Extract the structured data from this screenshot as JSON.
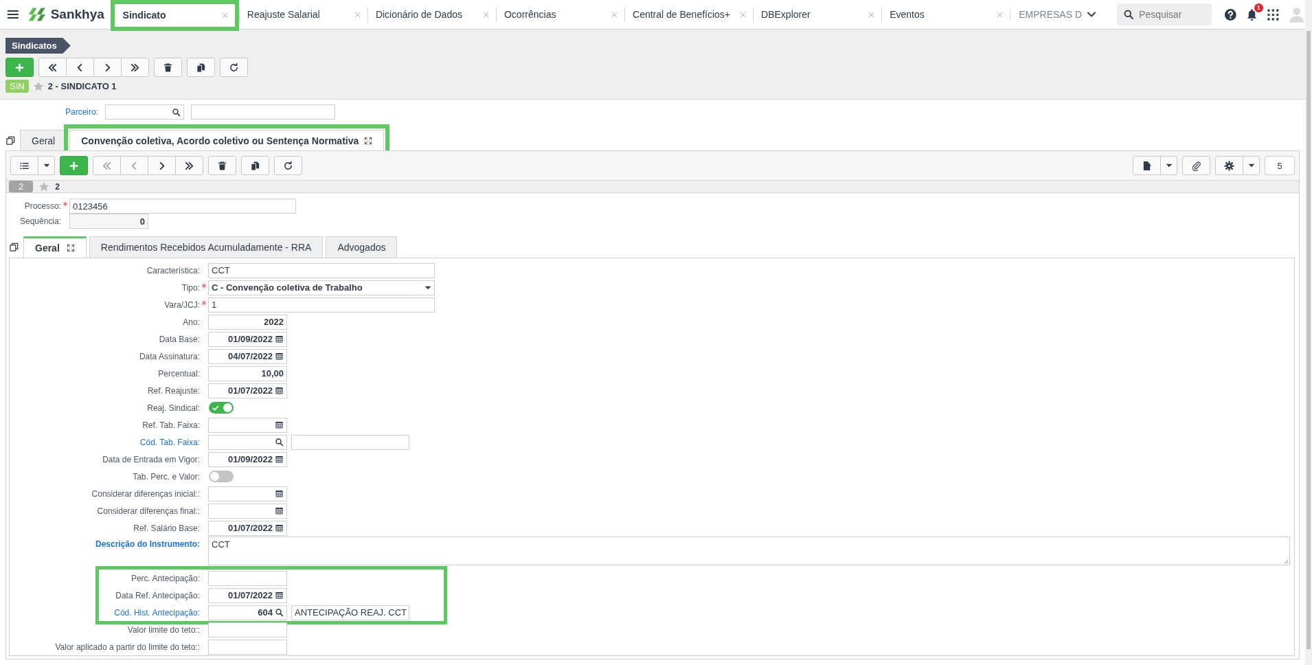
{
  "top_bar": {
    "brand": "Sankhya",
    "tabs": [
      {
        "label": "Sindicato",
        "selected": true,
        "highlighted": true
      },
      {
        "label": "Reajuste Salarial",
        "selected": false,
        "highlighted": false
      },
      {
        "label": "Dicionário de Dados",
        "selected": false,
        "highlighted": false
      },
      {
        "label": "Ocorrências",
        "selected": false,
        "highlighted": false
      },
      {
        "label": "Central de Benefícios+",
        "selected": false,
        "highlighted": false
      },
      {
        "label": "DBExplorer",
        "selected": false,
        "highlighted": false
      },
      {
        "label": "Eventos",
        "selected": false,
        "highlighted": false
      }
    ],
    "company_selector": {
      "label": "EMPRESAS D"
    },
    "search": {
      "placeholder": "Pesquisar"
    },
    "notification_count": "1"
  },
  "header": {
    "breadcrumb": "Sindicatos",
    "toolbar": [
      [
        {
          "kind": "add",
          "disabled": false
        }
      ],
      [
        {
          "kind": "first",
          "disabled": false
        },
        {
          "kind": "prev",
          "disabled": false
        },
        {
          "kind": "next",
          "disabled": false
        },
        {
          "kind": "last",
          "disabled": false
        }
      ],
      [
        {
          "kind": "trash",
          "disabled": false
        }
      ],
      [
        {
          "kind": "copy",
          "disabled": false
        }
      ],
      [
        {
          "kind": "refresh",
          "disabled": false
        }
      ]
    ],
    "badge": "SIN",
    "record_title": "2 - SINDICATO 1"
  },
  "form": {
    "parceiro": {
      "label": "Parceiro:"
    },
    "tabs": [
      {
        "label": "Geral",
        "selected": false,
        "highlighted": false
      },
      {
        "label": "Convenção coletiva, Acordo coletivo ou Sentença Normativa",
        "selected": true,
        "highlighted": true
      }
    ],
    "toolbar": [
      [
        {
          "kind": "list",
          "disabled": false
        },
        {
          "kind": "caret",
          "disabled": false
        }
      ],
      [
        {
          "kind": "add",
          "disabled": false
        }
      ],
      [
        {
          "kind": "first",
          "disabled": true
        },
        {
          "kind": "prev",
          "disabled": true
        },
        {
          "kind": "next",
          "disabled": false
        },
        {
          "kind": "last",
          "disabled": false
        }
      ],
      [
        {
          "kind": "trash",
          "disabled": false
        }
      ],
      [
        {
          "kind": "copy",
          "disabled": false
        }
      ],
      [
        {
          "kind": "refresh",
          "disabled": false
        }
      ]
    ],
    "toolbar_right": [
      [
        {
          "kind": "doc",
          "disabled": false
        },
        {
          "kind": "caret",
          "disabled": false
        }
      ],
      [
        {
          "kind": "clip",
          "disabled": false
        }
      ],
      [
        {
          "kind": "gear",
          "disabled": false
        },
        {
          "kind": "caret",
          "disabled": false
        }
      ]
    ],
    "record_count": "5",
    "record_badge": "2",
    "record_title": "2",
    "processo": {
      "label": "Processo:",
      "required": true,
      "value": "0123456"
    },
    "sequencia": {
      "label": "Sequência:",
      "value": "0"
    },
    "sub_tabs": [
      {
        "label": "Geral",
        "selected": true
      },
      {
        "label": "Rendimentos Recebidos Acumuladamente - RRA",
        "selected": false
      },
      {
        "label": "Advogados",
        "selected": false
      }
    ],
    "fields": [
      {
        "kind": "text",
        "label": "Característica:",
        "value": "CCT"
      },
      {
        "kind": "select",
        "label": "Tipo:",
        "required": true,
        "value": "C - Convenção coletiva de Trabalho"
      },
      {
        "kind": "text",
        "label": "Vara/JCJ:",
        "required": true,
        "value": "1"
      },
      {
        "kind": "number",
        "label": "Ano:",
        "value": "2022"
      },
      {
        "kind": "date",
        "label": "Data Base:",
        "value": "01/09/2022"
      },
      {
        "kind": "date",
        "label": "Data Assinatura:",
        "value": "04/07/2022"
      },
      {
        "kind": "number",
        "label": "Percentual:",
        "value": "10,00"
      },
      {
        "kind": "date",
        "label": "Ref. Reajuste:",
        "value": "01/07/2022"
      },
      {
        "kind": "toggle",
        "label": "Reaj. Sindical:",
        "on": true
      },
      {
        "kind": "date",
        "label": "Ref. Tab. Faixa:"
      },
      {
        "kind": "lookup",
        "label": "Cód. Tab. Faixa:",
        "link": true
      },
      {
        "kind": "date",
        "label": "Data de Entrada em Vigor:",
        "value": "01/09/2022"
      },
      {
        "kind": "toggle",
        "label": "Tab. Perc. e Valor:",
        "on": false
      },
      {
        "kind": "date",
        "label": "Considerar diferenças inicial::"
      },
      {
        "kind": "date",
        "label": "Considerar diferenças final::"
      },
      {
        "kind": "date",
        "label": "Ref. Salário Base:",
        "value": "01/07/2022"
      },
      {
        "kind": "textarea",
        "label": "Descrição do Instrumento:",
        "link": true,
        "emphasis": true,
        "value": "CCT"
      }
    ],
    "highlight_box": {
      "fields": [
        {
          "kind": "number",
          "label": "Perc. Antecipação:"
        },
        {
          "kind": "date",
          "label": "Data Ref. Antecipação:",
          "value": "01/07/2022"
        },
        {
          "kind": "lookup",
          "label": "Cód. Hist. Antecipação:",
          "link": true,
          "value": "604",
          "description": "ANTECIPAÇÃO REAJ. CCT"
        }
      ]
    },
    "fields_after": [
      {
        "kind": "number",
        "label": "Valor limite do teto::"
      },
      {
        "kind": "number",
        "label": "Valor aplicado a partir do limite do teto::"
      }
    ]
  }
}
